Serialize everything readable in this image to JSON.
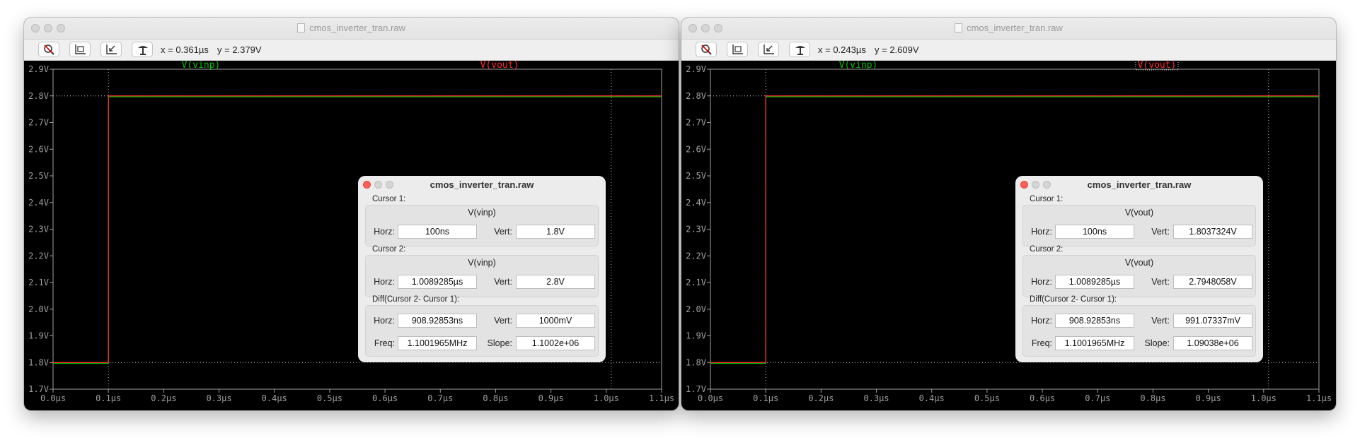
{
  "windows": [
    {
      "title": "cmos_inverter_tran.raw",
      "readout": {
        "x": "x = 0.361µs",
        "y": "y = 2.379V"
      },
      "traces": {
        "green_label": "V(vinp)",
        "red_label": "V(vout)",
        "green_highlighted": false,
        "red_highlighted": false
      },
      "cursor_dialog": {
        "title": "cmos_inverter_tran.raw",
        "cursor1": {
          "heading": "Cursor 1:",
          "signal": "V(vinp)",
          "horz_label": "Horz:",
          "horz": "100ns",
          "vert_label": "Vert:",
          "vert": "1.8V"
        },
        "cursor2": {
          "heading": "Cursor 2:",
          "signal": "V(vinp)",
          "horz_label": "Horz:",
          "horz": "1.0089285µs",
          "vert_label": "Vert:",
          "vert": "2.8V"
        },
        "diff": {
          "heading": "Diff(Cursor 2- Cursor 1):",
          "horz_label": "Horz:",
          "horz": "908.92853ns",
          "vert_label": "Vert:",
          "vert": "1000mV",
          "freq_label": "Freq:",
          "freq": "1.1001965MHz",
          "slope_label": "Slope:",
          "slope": "1.1002e+06"
        }
      }
    },
    {
      "title": "cmos_inverter_tran.raw",
      "readout": {
        "x": "x = 0.243µs",
        "y": "y = 2.609V"
      },
      "traces": {
        "green_label": "V(vinp)",
        "red_label": "V(vout)",
        "green_highlighted": false,
        "red_highlighted": true
      },
      "cursor_dialog": {
        "title": "cmos_inverter_tran.raw",
        "cursor1": {
          "heading": "Cursor 1:",
          "signal": "V(vout)",
          "horz_label": "Horz:",
          "horz": "100ns",
          "vert_label": "Vert:",
          "vert": "1.8037324V"
        },
        "cursor2": {
          "heading": "Cursor 2:",
          "signal": "V(vout)",
          "horz_label": "Horz:",
          "horz": "1.0089285µs",
          "vert_label": "Vert:",
          "vert": "2.7948058V"
        },
        "diff": {
          "heading": "Diff(Cursor 2- Cursor 1):",
          "horz_label": "Horz:",
          "horz": "908.92853ns",
          "vert_label": "Vert:",
          "vert": "991.07337mV",
          "freq_label": "Freq:",
          "freq": "1.1001965MHz",
          "slope_label": "Slope:",
          "slope": "1.09038e+06"
        }
      }
    }
  ],
  "toolbar_icons": [
    "zoom-cancel-icon",
    "zoom-full-icon",
    "zoom-back-icon",
    "autorange-icon"
  ],
  "chart_data": {
    "type": "line",
    "x_unit": "µs",
    "y_unit": "V",
    "xlim": [
      0.0,
      1.1
    ],
    "ylim": [
      1.7,
      2.9
    ],
    "x_ticks": [
      "0.0µs",
      "0.1µs",
      "0.2µs",
      "0.3µs",
      "0.4µs",
      "0.5µs",
      "0.6µs",
      "0.7µs",
      "0.8µs",
      "0.9µs",
      "1.0µs",
      "1.1µs"
    ],
    "y_ticks": [
      "1.7V",
      "1.8V",
      "1.9V",
      "2.0V",
      "2.1V",
      "2.2V",
      "2.3V",
      "2.4V",
      "2.5V",
      "2.6V",
      "2.7V",
      "2.8V",
      "2.9V"
    ],
    "y_tick_values": [
      1.7,
      1.8,
      1.9,
      2.0,
      2.1,
      2.2,
      2.3,
      2.4,
      2.5,
      2.6,
      2.7,
      2.8,
      2.9
    ],
    "x_tick_values": [
      0.0,
      0.1,
      0.2,
      0.3,
      0.4,
      0.5,
      0.6,
      0.7,
      0.8,
      0.9,
      1.0,
      1.1
    ],
    "series": [
      {
        "name": "V(vinp)",
        "color": "#00c000",
        "x": [
          0.0,
          0.1,
          0.1,
          1.1
        ],
        "y": [
          1.8,
          1.8,
          2.8,
          2.8
        ]
      },
      {
        "name": "V(vout)",
        "color": "#ff2a2a",
        "x": [
          0.0,
          0.1,
          0.1,
          1.1
        ],
        "y": [
          1.8,
          1.8,
          2.8,
          2.8
        ]
      }
    ],
    "cursors_x": [
      0.1,
      1.0089285
    ],
    "cursor_y": [
      1.8,
      2.8
    ],
    "grid": false
  },
  "colors": {
    "plot_background": "#000000",
    "axis": "#a0a0a0",
    "green_trace": "#00c000",
    "red_trace": "#ff2a2a",
    "cursor": "#c8c8c8"
  }
}
